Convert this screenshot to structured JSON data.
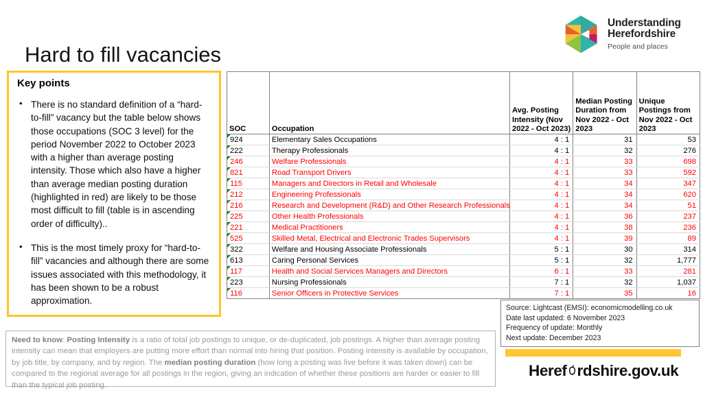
{
  "logo": {
    "title_line1": "Understanding",
    "title_line2": "Herefordshire",
    "subtitle": "People and places",
    "icon": "hexagon-pinwheel-logo",
    "colors": [
      "#2BB6A8",
      "#F5C23B",
      "#E8612C",
      "#C9156B",
      "#8CC63F",
      "#36A9A0"
    ]
  },
  "page": {
    "title": "Hard to fill vacancies"
  },
  "keypoints": {
    "heading": "Key points",
    "bullet_glyph": "•",
    "items": [
      "There is no standard definition of a “hard-to-fill” vacancy but the table below shows those occupations (SOC 3 level) for the period November 2022 to October 2023 with a higher than average posting intensity.  Those which also have a higher than average median posting duration (highlighted in red) are likely to be those most difficult to fill (table is in ascending order of difficulty)..",
      "This is the most timely proxy for “hard-to-fill” vacancies and although there are some issues associated with this methodology, it has been shown to be a robust approximation."
    ]
  },
  "table": {
    "headers": {
      "soc": "SOC",
      "occupation": "Occupation",
      "avg_posting_intensity": "Avg. Posting Intensity (Nov 2022 - Oct 2023)",
      "median_posting_duration": "Median Posting Duration from Nov 2022 - Oct 2023",
      "unique_postings": "Unique Postings from Nov 2022 - Oct 2023"
    },
    "highlight_color": "#FF0000",
    "rows": [
      {
        "soc": "924",
        "occupation": "Elementary Sales Occupations",
        "intensity": "4 : 1",
        "duration": "31",
        "postings": "53",
        "highlighted": false
      },
      {
        "soc": "222",
        "occupation": "Therapy Professionals",
        "intensity": "4 : 1",
        "duration": "32",
        "postings": "276",
        "highlighted": false
      },
      {
        "soc": "246",
        "occupation": "Welfare Professionals",
        "intensity": "4 : 1",
        "duration": "33",
        "postings": "698",
        "highlighted": true
      },
      {
        "soc": "821",
        "occupation": "Road Transport Drivers",
        "intensity": "4 : 1",
        "duration": "33",
        "postings": "592",
        "highlighted": true
      },
      {
        "soc": "115",
        "occupation": "Managers and Directors in Retail and Wholesale",
        "intensity": "4 : 1",
        "duration": "34",
        "postings": "347",
        "highlighted": true
      },
      {
        "soc": "212",
        "occupation": "Engineering Professionals",
        "intensity": "4 : 1",
        "duration": "34",
        "postings": "620",
        "highlighted": true
      },
      {
        "soc": "216",
        "occupation": "Research and Development (R&D) and Other Research Professionals",
        "intensity": "4 : 1",
        "duration": "34",
        "postings": "51",
        "highlighted": true
      },
      {
        "soc": "225",
        "occupation": "Other Health Professionals",
        "intensity": "4 : 1",
        "duration": "36",
        "postings": "237",
        "highlighted": true
      },
      {
        "soc": "221",
        "occupation": "Medical Practitioners",
        "intensity": "4 : 1",
        "duration": "38",
        "postings": "236",
        "highlighted": true
      },
      {
        "soc": "525",
        "occupation": "Skilled Metal, Electrical and Electronic Trades Supervisors",
        "intensity": "4 : 1",
        "duration": "39",
        "postings": "89",
        "highlighted": true
      },
      {
        "soc": "322",
        "occupation": "Welfare and Housing Associate Professionals",
        "intensity": "5 : 1",
        "duration": "30",
        "postings": "314",
        "highlighted": false
      },
      {
        "soc": "613",
        "occupation": "Caring Personal Services",
        "intensity": "5 : 1",
        "duration": "32",
        "postings": "1,777",
        "highlighted": false
      },
      {
        "soc": "117",
        "occupation": "Health and Social Services Managers and Directors",
        "intensity": "6 : 1",
        "duration": "33",
        "postings": "281",
        "highlighted": true
      },
      {
        "soc": "223",
        "occupation": "Nursing Professionals",
        "intensity": "7 : 1",
        "duration": "32",
        "postings": "1,037",
        "highlighted": false
      },
      {
        "soc": "116",
        "occupation": "Senior Officers in Protective Services",
        "intensity": "7 : 1",
        "duration": "35",
        "postings": "16",
        "highlighted": true
      }
    ]
  },
  "source": {
    "line1": "Source: Lightcast (EMSI): economicmodelling.co.uk",
    "line2": "Date last updated: 6 November 2023",
    "line3": "Frequency of update: Monthly",
    "line4": "Next update: December 2023"
  },
  "need_to_know": {
    "label": "Need to know",
    "term1": "Posting Intensity",
    "term2": "median posting duration",
    "part1": ": ",
    "part2": " is a ratio of total job postings to unique, or de-duplicated, job postings. A higher than average posting intensity can mean that employers are putting more effort than normal into hiring that position. Posting intensity is available by occupation, by job title, by company, and by region.  The ",
    "part3": " (how long a posting was live before it was taken down) can be compared to the regional average for all postings in the region, giving an indication of whether these positions are harder or easier to fill than the typical job posting."
  },
  "branding": {
    "text_before": "Heref",
    "text_after": "rdshire.gov.uk",
    "bar_color": "#FFC733"
  }
}
